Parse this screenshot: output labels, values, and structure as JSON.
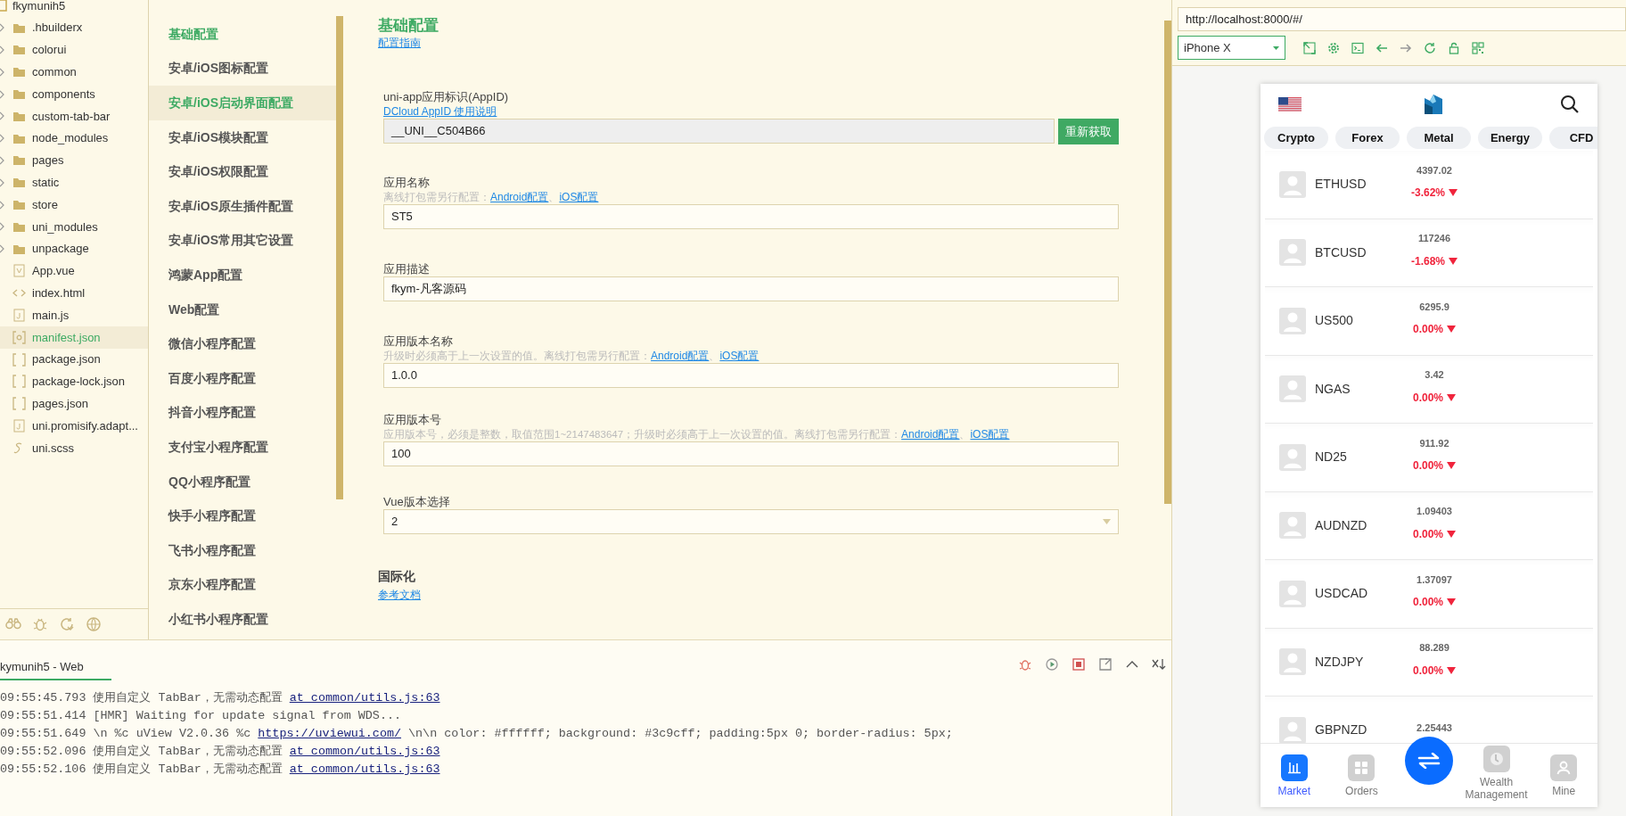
{
  "file_tree": {
    "root": "fkymunih5",
    "items": [
      {
        "name": ".hbuilderx",
        "kind": "folder",
        "selected": false
      },
      {
        "name": "colorui",
        "kind": "folder",
        "selected": false
      },
      {
        "name": "common",
        "kind": "folder",
        "selected": false
      },
      {
        "name": "components",
        "kind": "folder",
        "selected": false
      },
      {
        "name": "custom-tab-bar",
        "kind": "folder",
        "selected": false
      },
      {
        "name": "node_modules",
        "kind": "folder",
        "selected": false
      },
      {
        "name": "pages",
        "kind": "folder",
        "selected": false
      },
      {
        "name": "static",
        "kind": "folder",
        "selected": false
      },
      {
        "name": "store",
        "kind": "folder",
        "selected": false
      },
      {
        "name": "uni_modules",
        "kind": "folder",
        "selected": false
      },
      {
        "name": "unpackage",
        "kind": "folder",
        "selected": false
      },
      {
        "name": "App.vue",
        "kind": "vue",
        "selected": false
      },
      {
        "name": "index.html",
        "kind": "html",
        "selected": false
      },
      {
        "name": "main.js",
        "kind": "js",
        "selected": false
      },
      {
        "name": "manifest.json",
        "kind": "manifest",
        "selected": true
      },
      {
        "name": "package.json",
        "kind": "json",
        "selected": false
      },
      {
        "name": "package-lock.json",
        "kind": "json",
        "selected": false
      },
      {
        "name": "pages.json",
        "kind": "json",
        "selected": false
      },
      {
        "name": "uni.promisify.adapt...",
        "kind": "js",
        "selected": false
      },
      {
        "name": "uni.scss",
        "kind": "scss",
        "selected": false
      }
    ]
  },
  "config_nav": {
    "items": [
      {
        "label": "基础配置",
        "active": true,
        "hovered": false
      },
      {
        "label": "安卓/iOS图标配置",
        "active": false,
        "hovered": false
      },
      {
        "label": "安卓/iOS启动界面配置",
        "active": true,
        "hovered": true
      },
      {
        "label": "安卓/iOS模块配置",
        "active": false,
        "hovered": false
      },
      {
        "label": "安卓/iOS权限配置",
        "active": false,
        "hovered": false
      },
      {
        "label": "安卓/iOS原生插件配置",
        "active": false,
        "hovered": false
      },
      {
        "label": "安卓/iOS常用其它设置",
        "active": false,
        "hovered": false
      },
      {
        "label": "鸿蒙App配置",
        "active": false,
        "hovered": false
      },
      {
        "label": "Web配置",
        "active": false,
        "hovered": false
      },
      {
        "label": "微信小程序配置",
        "active": false,
        "hovered": false
      },
      {
        "label": "百度小程序配置",
        "active": false,
        "hovered": false
      },
      {
        "label": "抖音小程序配置",
        "active": false,
        "hovered": false
      },
      {
        "label": "支付宝小程序配置",
        "active": false,
        "hovered": false
      },
      {
        "label": "QQ小程序配置",
        "active": false,
        "hovered": false
      },
      {
        "label": "快手小程序配置",
        "active": false,
        "hovered": false
      },
      {
        "label": "飞书小程序配置",
        "active": false,
        "hovered": false
      },
      {
        "label": "京东小程序配置",
        "active": false,
        "hovered": false
      },
      {
        "label": "小红书小程序配置",
        "active": false,
        "hovered": false
      }
    ]
  },
  "section": {
    "title": "基础配置",
    "guide_link": "配置指南",
    "fields": [
      {
        "kind": "input",
        "label": "uni-app应用标识(AppID)",
        "help_link": "DCloud AppID 使用说明",
        "value": "__UNI__C504B66",
        "readonly": true,
        "button": "重新获取"
      },
      {
        "kind": "input",
        "label": "应用名称",
        "hint": [
          {
            "kind": "text",
            "text": "离线打包需另行配置："
          },
          {
            "kind": "link",
            "text": "Android配置"
          },
          {
            "kind": "text",
            "text": "、"
          },
          {
            "kind": "link",
            "text": "iOS配置"
          }
        ],
        "value": "ST5",
        "readonly": false
      },
      {
        "kind": "input",
        "label": "应用描述",
        "value": "fkym-凡客源码",
        "readonly": false
      },
      {
        "kind": "input",
        "label": "应用版本名称",
        "hint": [
          {
            "kind": "text",
            "text": "升级时必须高于上一次设置的值。离线打包需另行配置："
          },
          {
            "kind": "link",
            "text": "Android配置"
          },
          {
            "kind": "text",
            "text": "、"
          },
          {
            "kind": "link",
            "text": "iOS配置"
          }
        ],
        "value": "1.0.0",
        "readonly": false
      },
      {
        "kind": "input",
        "label": "应用版本号",
        "hint": [
          {
            "kind": "text",
            "text": "应用版本号，必须是整数，取值范围1~2147483647；升级时必须高于上一次设置的值。离线打包需另行配置："
          },
          {
            "kind": "link",
            "text": "Android配置"
          },
          {
            "kind": "text",
            "text": "、"
          },
          {
            "kind": "link",
            "text": "iOS配置"
          }
        ],
        "value": "100",
        "readonly": false
      },
      {
        "kind": "select",
        "label": "Vue版本选择",
        "value": "2"
      }
    ],
    "i18n": {
      "title": "国际化",
      "link": "参考文档"
    }
  },
  "preview": {
    "url": "http://localhost:8000/#/",
    "device": "iPhone X",
    "categories": [
      {
        "label": "Crypto"
      },
      {
        "label": "Forex"
      },
      {
        "label": "Metal"
      },
      {
        "label": "Energy"
      },
      {
        "label": "CFD"
      }
    ],
    "rows": [
      {
        "symbol": "ETHUSD",
        "price": "4397.02",
        "change": "-3.62%",
        "falling": true
      },
      {
        "symbol": "BTCUSD",
        "price": "117246",
        "change": "-1.68%",
        "falling": true
      },
      {
        "symbol": "US500",
        "price": "6295.9",
        "change": "0.00%",
        "falling": true
      },
      {
        "symbol": "NGAS",
        "price": "3.42",
        "change": "0.00%",
        "falling": true
      },
      {
        "symbol": "ND25",
        "price": "911.92",
        "change": "0.00%",
        "falling": true
      },
      {
        "symbol": "AUDNZD",
        "price": "1.09403",
        "change": "0.00%",
        "falling": true
      },
      {
        "symbol": "USDCAD",
        "price": "1.37097",
        "change": "0.00%",
        "falling": true
      },
      {
        "symbol": "NZDJPY",
        "price": "88.289",
        "change": "0.00%",
        "falling": true
      },
      {
        "symbol": "GBPNZD",
        "price": "2.25443"
      }
    ],
    "tabs": [
      {
        "kind": "chart",
        "label": "Market",
        "selected": true
      },
      {
        "kind": "grid",
        "label": "Orders",
        "selected": false
      },
      {
        "kind": "swap"
      },
      {
        "kind": "clock",
        "label": "Wealth Management",
        "selected": false
      },
      {
        "kind": "person",
        "label": "Mine",
        "selected": false
      }
    ]
  },
  "console": {
    "title": "kymunih5 - Web",
    "lines": [
      {
        "time": "09:55:45.793",
        "parts": [
          {
            "kind": "text",
            "text": "使用自定义 TabBar，无需动态配置 "
          },
          {
            "kind": "link",
            "text": "at common/utils.js:63"
          }
        ]
      },
      {
        "time": "09:55:51.414",
        "parts": [
          {
            "kind": "text",
            "text": "[HMR] Waiting for update signal from WDS..."
          }
        ]
      },
      {
        "time": "09:55:51.649",
        "parts": [
          {
            "kind": "text",
            "text": "\\n %c uView V2.0.36 %c "
          },
          {
            "kind": "link",
            "text": "https://uviewui.com/"
          },
          {
            "kind": "text",
            "text": " \\n\\n color: #ffffff; background: #3c9cff; padding:5px 0; border-radius: 5px;"
          }
        ]
      },
      {
        "time": "09:55:52.096",
        "parts": [
          {
            "kind": "text",
            "text": "使用自定义 TabBar，无需动态配置 "
          },
          {
            "kind": "link",
            "text": "at common/utils.js:63"
          }
        ]
      },
      {
        "time": "09:55:52.106",
        "parts": [
          {
            "kind": "text",
            "text": "使用自定义 TabBar，无需动态配置 "
          },
          {
            "kind": "link",
            "text": "at common/utils.js:63"
          }
        ]
      }
    ]
  }
}
